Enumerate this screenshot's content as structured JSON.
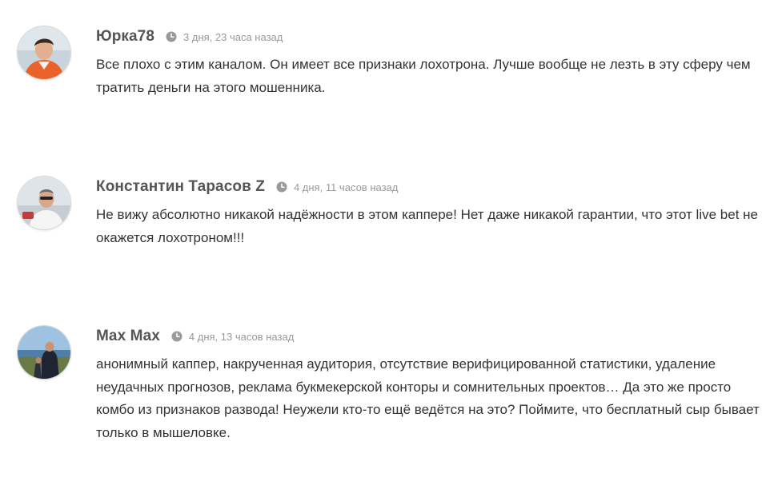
{
  "comments": [
    {
      "author": "Юрка78",
      "time": "3 дня, 23 часа назад",
      "text": "Все плохо с этим каналом. Он имеет все признаки лохотрона. Лучше вообще не лезть в эту сферу чем тратить деньги на этого мошенника.",
      "avatar_icon": "user-photo-icon"
    },
    {
      "author": "Константин Тарасов Z",
      "time": "4 дня, 11 часов назад",
      "text": "Не вижу абсолютно никакой надёжности в этом каппере! Нет даже никакой гарантии, что этот live bet не окажется лохотроном!!!",
      "avatar_icon": "user-photo-icon"
    },
    {
      "author": "Max Max",
      "time": "4 дня, 13 часов назад",
      "text": "анонимный каппер, накрученная аудитория, отсутствие верифицированной статистики, удаление неудачных прогнозов, реклама букмекерской конторы и сомнительных проектов… Да это же просто комбо из признаков развода! Неужели кто-то ещё ведётся на это? Поймите, что бесплатный сыр бывает только в мышеловке.",
      "avatar_icon": "user-photo-icon"
    }
  ],
  "colors": {
    "author": "#555555",
    "time": "#999999",
    "text": "#333333",
    "clock": "#9a9a9a"
  },
  "icons": {
    "clock": "clock-icon"
  }
}
